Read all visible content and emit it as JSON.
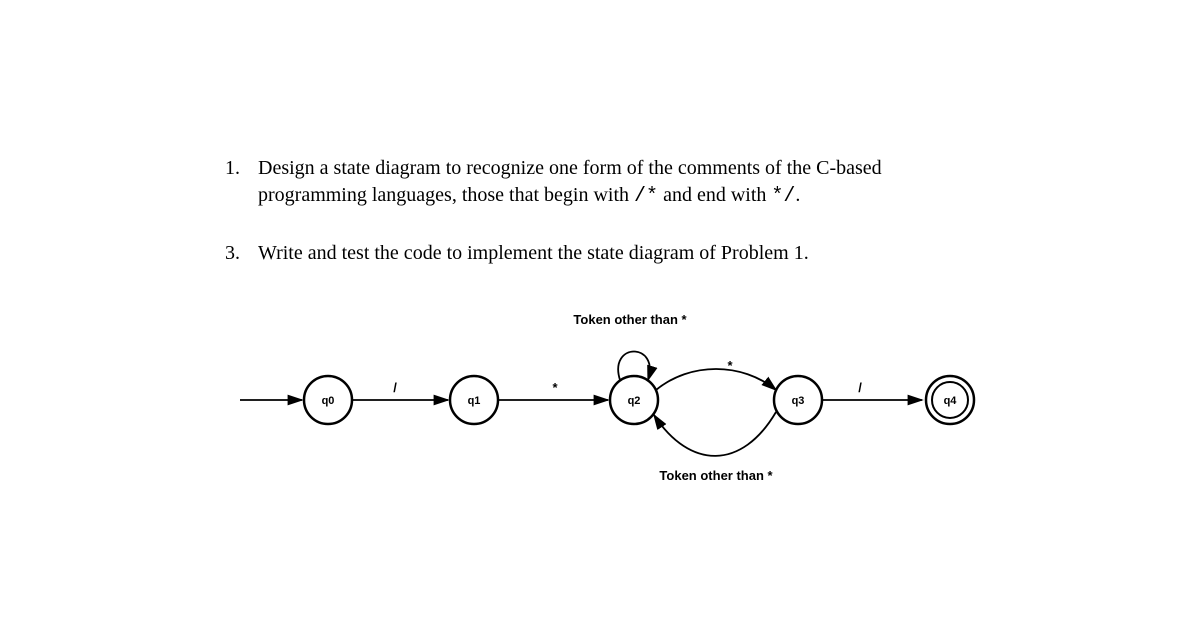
{
  "problems": [
    {
      "number": "1.",
      "text_before": "Design a state diagram to recognize one form of the comments of the C-based programming languages, those that begin with ",
      "code1": "/*",
      "mid": " and end with ",
      "code2": "*/",
      "after": "."
    },
    {
      "number": "3.",
      "text": "Write and test the code to implement the state diagram of Problem 1."
    }
  ],
  "diagram": {
    "states": [
      {
        "id": "q0",
        "label": "q0",
        "accepting": false
      },
      {
        "id": "q1",
        "label": "q1",
        "accepting": false
      },
      {
        "id": "q2",
        "label": "q2",
        "accepting": false
      },
      {
        "id": "q3",
        "label": "q3",
        "accepting": false
      },
      {
        "id": "q4",
        "label": "q4",
        "accepting": true
      }
    ],
    "edges": [
      {
        "from": "start",
        "to": "q0",
        "label": ""
      },
      {
        "from": "q0",
        "to": "q1",
        "label": "/"
      },
      {
        "from": "q1",
        "to": "q2",
        "label": "*"
      },
      {
        "from": "q2",
        "to": "q2",
        "label": "Token other than *"
      },
      {
        "from": "q2",
        "to": "q3",
        "label": "*"
      },
      {
        "from": "q3",
        "to": "q2",
        "label": "Token other than *"
      },
      {
        "from": "q3",
        "to": "q4",
        "label": "/"
      }
    ],
    "notes": {
      "top": "Token other than *",
      "bottom": "Token other than *"
    }
  }
}
